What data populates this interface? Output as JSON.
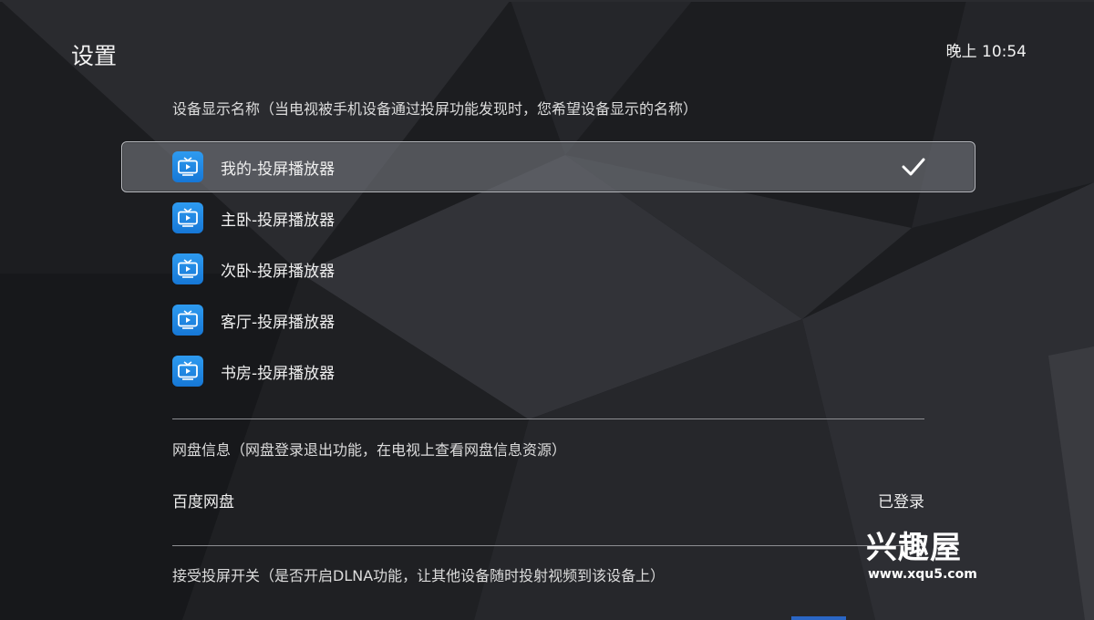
{
  "header": {
    "title": "设置",
    "time": "晚上 10:54"
  },
  "device_name_section": {
    "heading": "设备显示名称（当电视被手机设备通过投屏功能发现时，您希望设备显示的名称）",
    "options": [
      {
        "label": "我的-投屏播放器",
        "icon": "tv-play-icon",
        "selected": true
      },
      {
        "label": "主卧-投屏播放器",
        "icon": "tv-play-icon",
        "selected": false
      },
      {
        "label": "次卧-投屏播放器",
        "icon": "tv-play-icon",
        "selected": false
      },
      {
        "label": "客厅-投屏播放器",
        "icon": "tv-play-icon",
        "selected": false
      },
      {
        "label": "书房-投屏播放器",
        "icon": "tv-play-icon",
        "selected": false
      }
    ],
    "selected_icon": "checkmark-icon"
  },
  "cloud_section": {
    "heading": "网盘信息（网盘登录退出功能，在电视上查看网盘信息资源）",
    "account": {
      "label": "百度网盘",
      "status": "已登录"
    }
  },
  "receive_section": {
    "heading": "接受投屏开关（是否开启DLNA功能，让其他设备随时投射视频到该设备上）"
  },
  "watermark": {
    "logo_text": "兴趣屋",
    "url": "www.xqu5.com"
  },
  "colors": {
    "background": "#1b1c1f",
    "icon_blue": "#1e88e5",
    "selected_bg": "#6c6e74",
    "text": "#f0f0f0"
  }
}
